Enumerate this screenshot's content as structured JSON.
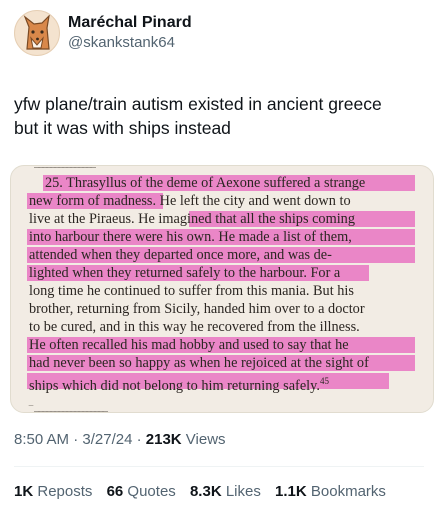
{
  "author": {
    "name": "Maréchal Pinard",
    "handle": "@skankstank64",
    "avatar_icon": "fox-avatar-icon"
  },
  "tweet_text_line1": "yfw plane/train autism existed in ancient greece",
  "tweet_text_line2": "but it was with ships instead",
  "image": {
    "lines": [
      "25. Thrasyllus of the deme of Aexone suffered a strange",
      "new form of madness. He left the city and went down to",
      "live at the Piraeus. He imagined that all the ships coming",
      "into harbour there were his own. He made a list of them,",
      "attended when they departed once more, and was de-",
      "lighted when they returned safely to the harbour. For a",
      "long time he continued to suffer from this mania. But his",
      "brother, returning from Sicily, handed him over to a doctor",
      "to be cured, and in this way he recovered from the illness.",
      "He often recalled his mad hobby and used to say that he",
      "had never been so happy as when he rejoiced at the sight of",
      "ships which did not belong to him returning safely."
    ],
    "footnote_marker": "45"
  },
  "meta": {
    "time": "8:50 AM",
    "sep": " · ",
    "date": "3/27/24",
    "views_count": "213K",
    "views_label": " Views"
  },
  "stats": {
    "reposts_count": "1K",
    "reposts_label": "Reposts",
    "quotes_count": "66",
    "quotes_label": "Quotes",
    "likes_count": "8.3K",
    "likes_label": "Likes",
    "bookmarks_count": "1.1K",
    "bookmarks_label": "Bookmarks"
  },
  "colors": {
    "highlight": "#ea86c7",
    "secondary_text": "#536471",
    "primary_text": "#0f1419"
  }
}
